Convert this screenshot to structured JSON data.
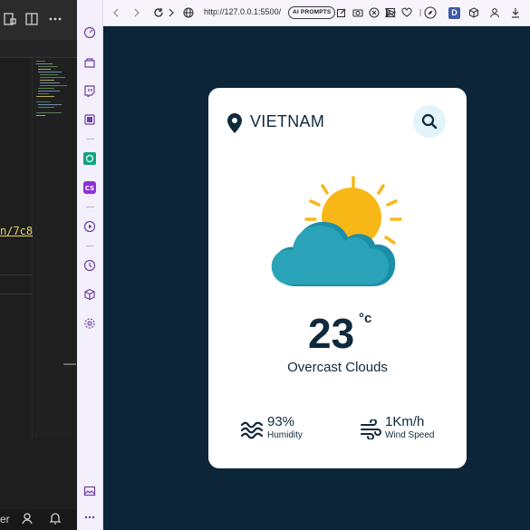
{
  "editor": {
    "highlighted_text": "n/7c8",
    "bottom_text": "er"
  },
  "browser": {
    "url": "http://127.0.0.1:5500/",
    "ai_prompts_label": "AI PROMPTS",
    "ext_badge": "D"
  },
  "weather": {
    "location": "VIETNAM",
    "temperature": "23",
    "unit": "°c",
    "description": "Overcast Clouds",
    "humidity": {
      "value": "93%",
      "label": "Humidity"
    },
    "wind": {
      "value": "1Km/h",
      "label": "Wind Speed"
    }
  },
  "colors": {
    "page_bg": "#0d2538",
    "card_bg": "#ffffff",
    "text_dark": "#0f2a3d",
    "sun": "#f7b817",
    "cloud": "#2aa3b8",
    "search_bg": "#e2f3fa"
  }
}
